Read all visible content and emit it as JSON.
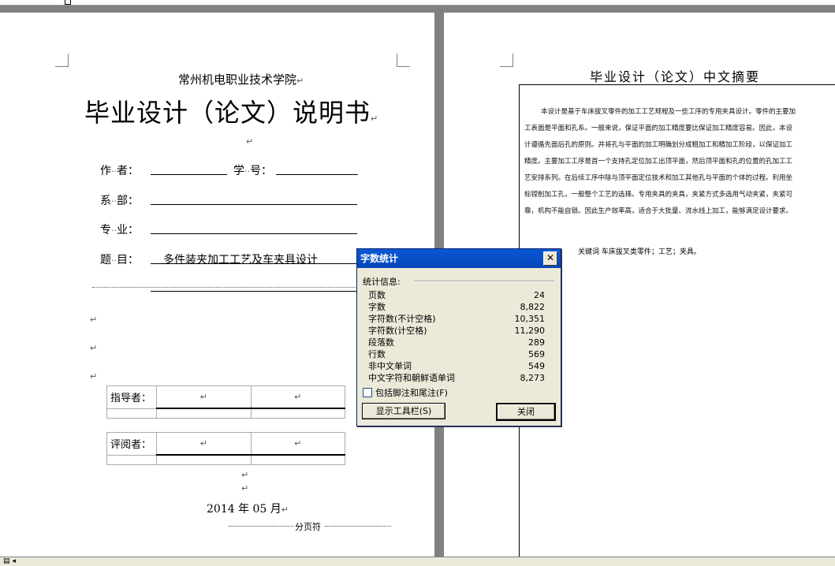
{
  "page1": {
    "school": "常州机电职业技术学院",
    "doc_title": "毕业设计（论文）说明书",
    "author_label": "作",
    "author_label2": "者：",
    "student_id_label": "学",
    "student_id_label2": "号：",
    "dept_label": "系",
    "dept_label2": "部：",
    "major_label": "专",
    "major_label2": "业：",
    "topic_label": "题",
    "topic_label2": "目：",
    "topic_value": "多件装夹加工工艺及车夹具设计",
    "advisor_label": "指导者：",
    "reviewer_label": "评阅者：",
    "date": "2014 年 05 月",
    "page_break": "分页符",
    "para_mark": "↵"
  },
  "page2": {
    "title": "毕业设计（论文）中文摘要",
    "abstract_lines": [
      "本设计是基于车床拔叉零件的加工工艺规程及一些工序的专用夹具设计。零件的主要加",
      "工表面是平面和孔系。一般来说，保证平面的加工精度要比保证加工精度容易。因此，本设",
      "计遵循先面后孔的原则。并将孔与平面的加工明确划分成粗加工和精加工阶段，以保证加工",
      "精度。主要加工工序是首一个支持孔定位加工出顶平面，然后顶平面和孔的位置的孔加工工",
      "艺安排系列。在后续工序中除与顶平面定位技术和加工其他孔与平面的个体的过程。利用坐",
      "标镗削加工孔，一般整个工艺的选择。专用夹具的夹具，夹紧方式多选用气动夹紧，夹紧可",
      "靠，机构不能自锁。因此生产效率高，适合于大批量、流水线上加工，能够满足设计要求。"
    ],
    "keywords": "关键词  车床拔叉类零件；工艺；夹具。"
  },
  "dialog": {
    "title": "字数统计",
    "section_label": "统计信息:",
    "stats": [
      {
        "label": "页数",
        "value": "24"
      },
      {
        "label": "字数",
        "value": "8,822"
      },
      {
        "label": "字符数(不计空格)",
        "value": "10,351"
      },
      {
        "label": "字符数(计空格)",
        "value": "11,290"
      },
      {
        "label": "段落数",
        "value": "289"
      },
      {
        "label": "行数",
        "value": "569"
      },
      {
        "label": "非中文单词",
        "value": "549"
      },
      {
        "label": "中文字符和朝鲜语单词",
        "value": "8,273"
      }
    ],
    "checkbox_label": "包括脚注和尾注(F)",
    "checkbox_checked": false,
    "toolbar_button": "显示工具栏(S)",
    "close_button": "关闭"
  },
  "colors": {
    "titlebar": "#0a58d4",
    "dialog_bg": "#ece9d8",
    "workspace": "#808080"
  }
}
